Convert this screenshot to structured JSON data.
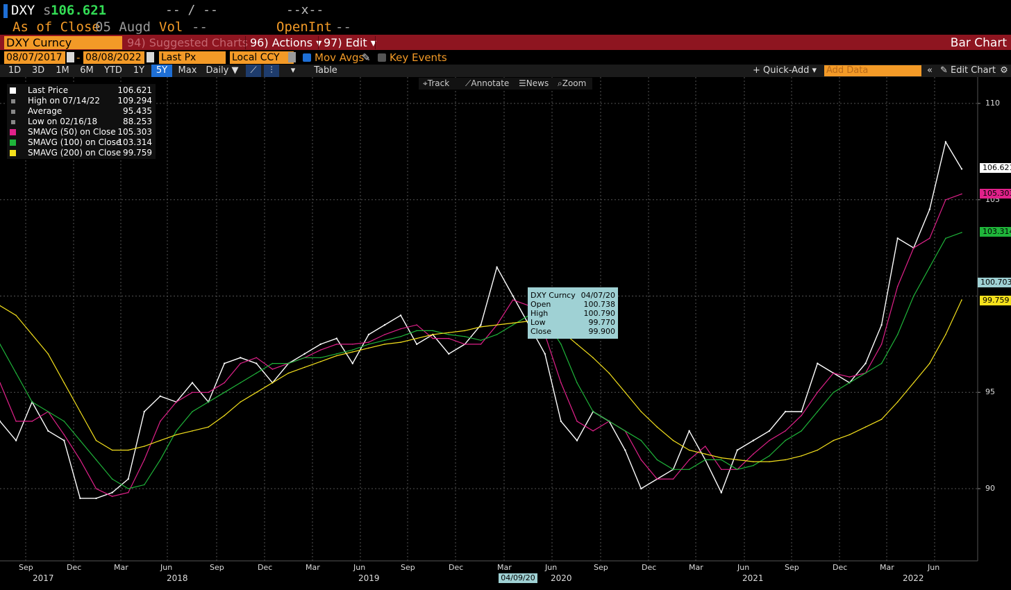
{
  "header": {
    "ticker": "DXY",
    "price_prefix": "s",
    "price": "106.621",
    "change": "-- / --",
    "bidask": "--x--",
    "asof_label": "As of Close",
    "asof_date": "05 Augd",
    "vol_label": "Vol",
    "vol_value": "--",
    "openint_label": "OpenInt",
    "openint_value": "--"
  },
  "funcbar": {
    "security": "DXY Curncy",
    "suggested": "94) Suggested Charts",
    "actions": "96) Actions ▾",
    "edit": "97) Edit ▾",
    "title": "Bar Chart"
  },
  "daterow": {
    "start": "08/07/2017",
    "end": "08/08/2022",
    "field": "Last Px",
    "currency": "Local CCY",
    "mov_avgs": "Mov Avgs",
    "key_events": "Key Events"
  },
  "toolbar": {
    "periods": [
      "1D",
      "3D",
      "1M",
      "6M",
      "YTD",
      "1Y",
      "5Y",
      "Max"
    ],
    "active_period": "5Y",
    "frequency": "Daily ▼",
    "table": "Table",
    "quick_add": "+ Quick-Add ▾",
    "add_data_placeholder": "Add Data",
    "edit_chart": "Edit Chart"
  },
  "chart_tools": {
    "track": "Track",
    "annotate": "Annotate",
    "news": "News",
    "zoom": "Zoom"
  },
  "legend": [
    {
      "label": "Last Price",
      "value": "106.621",
      "color": "#ffffff"
    },
    {
      "label": "High on 07/14/22",
      "value": "109.294",
      "color": "#888888"
    },
    {
      "label": "Average",
      "value": "95.435",
      "color": "#888888"
    },
    {
      "label": "Low on 02/16/18",
      "value": "88.253",
      "color": "#888888"
    },
    {
      "label": "SMAVG (50)  on Close",
      "value": "105.303",
      "color": "#e0218a"
    },
    {
      "label": "SMAVG (100)  on Close",
      "value": "103.314",
      "color": "#1fb53a"
    },
    {
      "label": "SMAVG (200)  on Close",
      "value": "99.759",
      "color": "#f5e11c"
    }
  ],
  "tooltip": {
    "title": "DXY Curncy",
    "date": "04/07/20",
    "rows": [
      {
        "label": "Open",
        "value": "100.738"
      },
      {
        "label": "High",
        "value": "100.790"
      },
      {
        "label": "Low",
        "value": "99.770"
      },
      {
        "label": "Close",
        "value": "99.900"
      }
    ]
  },
  "value_tags": [
    {
      "text": "106.621",
      "bg": "#ffffff"
    },
    {
      "text": "105.303",
      "bg": "#e0218a"
    },
    {
      "text": "103.314",
      "bg": "#1fb53a"
    },
    {
      "text": "100.703",
      "bg": "#9fd1d4"
    },
    {
      "text": "99.759",
      "bg": "#f5e11c"
    }
  ],
  "date_tag": "04/09/20",
  "chart_data": {
    "type": "line",
    "title": "",
    "ylim": [
      86,
      112
    ],
    "y_ticks": [
      110,
      105,
      95,
      90
    ],
    "x_month_labels": [
      "Sep",
      "Dec",
      "Mar",
      "Jun",
      "Sep",
      "Dec",
      "Mar",
      "Jun",
      "Sep",
      "Dec",
      "Mar",
      "Jun",
      "Sep",
      "Dec",
      "Mar",
      "Jun",
      "Sep",
      "Dec",
      "Mar",
      "Jun"
    ],
    "x_year_labels": [
      "2017",
      "2018",
      "2019",
      "2020",
      "2021",
      "2022"
    ],
    "x_dates": [
      "2017-08",
      "2017-09",
      "2017-10",
      "2017-11",
      "2017-12",
      "2018-01",
      "2018-02",
      "2018-03",
      "2018-04",
      "2018-05",
      "2018-06",
      "2018-07",
      "2018-08",
      "2018-09",
      "2018-10",
      "2018-11",
      "2018-12",
      "2019-01",
      "2019-02",
      "2019-03",
      "2019-04",
      "2019-05",
      "2019-06",
      "2019-07",
      "2019-08",
      "2019-09",
      "2019-10",
      "2019-11",
      "2019-12",
      "2020-01",
      "2020-02",
      "2020-03",
      "2020-04",
      "2020-05",
      "2020-06",
      "2020-07",
      "2020-08",
      "2020-09",
      "2020-10",
      "2020-11",
      "2020-12",
      "2021-01",
      "2021-02",
      "2021-03",
      "2021-04",
      "2021-05",
      "2021-06",
      "2021-07",
      "2021-08",
      "2021-09",
      "2021-10",
      "2021-11",
      "2021-12",
      "2022-01",
      "2022-02",
      "2022-03",
      "2022-04",
      "2022-05",
      "2022-06",
      "2022-07",
      "2022-08"
    ],
    "series": [
      {
        "name": "Last Price",
        "color": "#ffffff",
        "values": [
          93.5,
          92.5,
          94.5,
          93.0,
          92.5,
          89.5,
          89.5,
          89.8,
          90.5,
          94.0,
          94.8,
          94.5,
          95.5,
          94.5,
          96.5,
          96.8,
          96.5,
          95.5,
          96.5,
          97.0,
          97.5,
          97.8,
          96.5,
          98.0,
          98.5,
          99.0,
          97.5,
          98.0,
          97.0,
          97.5,
          98.5,
          101.5,
          100.0,
          98.5,
          97.0,
          93.5,
          92.5,
          94.0,
          93.5,
          92.0,
          90.0,
          90.5,
          91.0,
          93.0,
          91.5,
          89.8,
          92.0,
          92.5,
          93.0,
          94.0,
          94.0,
          96.5,
          96.0,
          95.5,
          96.5,
          98.5,
          103.0,
          102.5,
          104.5,
          108.0,
          106.6
        ]
      },
      {
        "name": "SMAVG (50)",
        "color": "#e0218a",
        "values": [
          95.5,
          93.5,
          93.5,
          94.0,
          92.8,
          91.5,
          90.0,
          89.6,
          89.8,
          91.5,
          93.5,
          94.5,
          95.0,
          95.0,
          95.5,
          96.5,
          96.8,
          96.2,
          96.5,
          96.8,
          97.2,
          97.5,
          97.5,
          97.6,
          98.0,
          98.3,
          98.5,
          97.8,
          97.8,
          97.5,
          97.5,
          98.5,
          99.8,
          99.5,
          98.0,
          95.5,
          93.5,
          93.0,
          93.5,
          93.0,
          91.5,
          90.5,
          90.5,
          91.5,
          92.2,
          91.0,
          91.0,
          91.8,
          92.5,
          93.0,
          93.8,
          95.0,
          96.0,
          95.8,
          96.0,
          97.5,
          100.5,
          102.5,
          103.0,
          105.0,
          105.3
        ]
      },
      {
        "name": "SMAVG (100)",
        "color": "#1fb53a",
        "values": [
          97.5,
          96.0,
          94.5,
          94.0,
          93.5,
          92.5,
          91.5,
          90.5,
          90.0,
          90.2,
          91.5,
          93.0,
          94.0,
          94.5,
          95.0,
          95.5,
          96.0,
          96.5,
          96.5,
          96.8,
          96.8,
          97.0,
          97.2,
          97.5,
          97.7,
          97.9,
          98.2,
          98.2,
          98.0,
          97.9,
          97.7,
          98.0,
          98.5,
          99.0,
          98.8,
          97.5,
          95.5,
          94.0,
          93.5,
          93.0,
          92.5,
          91.5,
          91.0,
          91.0,
          91.5,
          91.5,
          91.0,
          91.2,
          91.7,
          92.5,
          93.0,
          94.0,
          95.0,
          95.5,
          96.0,
          96.5,
          98.0,
          100.0,
          101.5,
          103.0,
          103.3
        ]
      },
      {
        "name": "SMAVG (200)",
        "color": "#f5e11c",
        "values": [
          99.5,
          99.0,
          98.0,
          97.0,
          95.5,
          94.0,
          92.5,
          92.0,
          92.0,
          92.2,
          92.5,
          92.8,
          93.0,
          93.2,
          93.8,
          94.5,
          95.0,
          95.5,
          96.0,
          96.3,
          96.6,
          96.9,
          97.1,
          97.3,
          97.5,
          97.6,
          97.8,
          98.0,
          98.1,
          98.2,
          98.4,
          98.5,
          98.6,
          98.7,
          98.5,
          98.2,
          97.5,
          96.8,
          96.0,
          95.0,
          94.0,
          93.2,
          92.5,
          92.0,
          91.8,
          91.6,
          91.5,
          91.4,
          91.4,
          91.5,
          91.7,
          92.0,
          92.5,
          92.8,
          93.2,
          93.6,
          94.5,
          95.5,
          96.5,
          98.0,
          99.8
        ]
      }
    ]
  }
}
